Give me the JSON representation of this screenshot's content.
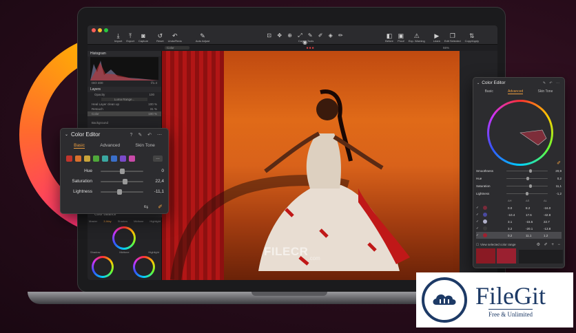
{
  "toolbar": {
    "tools_left": [
      "Import",
      "Export",
      "Capture",
      "Reset",
      "Undo/Redo"
    ],
    "tool_auto": "Auto Adjust",
    "cursor_tools_label": "Cursor Tools",
    "tools_right": [
      "Before",
      "Proof",
      "Exp. Warning",
      "Learn",
      "Edit Selected",
      "Copy/Apply"
    ]
  },
  "subbar": {
    "layer_name": "Color",
    "zoom": "55%"
  },
  "left_tools": {
    "histogram_title": "Histogram",
    "histogram_iso": "ISO 400",
    "histogram_aperture": "f/1.4",
    "layers_title": "Layers",
    "opacity_label": "Opacity",
    "opacity_value": "100",
    "luma_range_label": "Luma Range...",
    "layers": [
      {
        "name": "Heal Layer clean up",
        "value": "100 %"
      },
      {
        "name": "Retouch",
        "value": "31 %"
      },
      {
        "name": "Color",
        "value": "100 %"
      }
    ],
    "background_label": "Background",
    "color_balance_title": "Color Balance",
    "color_balance_tabs": [
      "Master",
      "3-Way",
      "Shadow",
      "Midtone",
      "Highlight"
    ],
    "wheel_labels": [
      "Shadow",
      "Midtone",
      "Highlight"
    ]
  },
  "color_editor_left": {
    "title": "Color Editor",
    "tabs": [
      "Basic",
      "Advanced",
      "Skin Tone"
    ],
    "active_tab": "Basic",
    "swatches": [
      "#c0342c",
      "#d9702c",
      "#c9a43a",
      "#4fa83a",
      "#3aa7a0",
      "#3a6fc9",
      "#7a4ac9",
      "#c94aa8"
    ],
    "hue_label": "Hue",
    "hue_value": "0",
    "saturation_label": "Saturation",
    "saturation_value": "22,4",
    "lightness_label": "Lightness",
    "lightness_value": "-11,1"
  },
  "color_editor_right": {
    "title": "Color Editor",
    "tabs": [
      "Basic",
      "Advanced",
      "Skin Tone"
    ],
    "active_tab": "Advanced",
    "smoothness_label": "Smoothness",
    "smoothness_value": "20,9",
    "hue_label": "Hue",
    "hue_value": "0,2",
    "saturation_label": "Saturation",
    "saturation_value": "11,1",
    "lightness_label": "Lightness",
    "lightness_value": "-1,2",
    "table_headers": [
      "ΔH",
      "ΔS",
      "ΔL"
    ],
    "table_rows": [
      {
        "color": "#7a2a3a",
        "h": "0.0",
        "s": "8.2",
        "l": "-16.0"
      },
      {
        "color": "#4a4aa0",
        "h": "-10.4",
        "s": "17.6",
        "l": "-42.8"
      },
      {
        "color": "#b0b0c8",
        "h": "3.1",
        "s": "-15.5",
        "l": "22.7"
      },
      {
        "color": "#3a3a3a",
        "h": "3.2",
        "s": "-20.1",
        "l": "-13.8"
      },
      {
        "color": "#a02030",
        "h": "0.2",
        "s": "11.1",
        "l": "1.2"
      }
    ],
    "view_range_label": "View selected color range"
  },
  "watermark": {
    "brand": "FILECR",
    "suffix": ".com"
  },
  "filegit": {
    "title": "FileGit",
    "subtitle": "Free & Unlimited"
  }
}
